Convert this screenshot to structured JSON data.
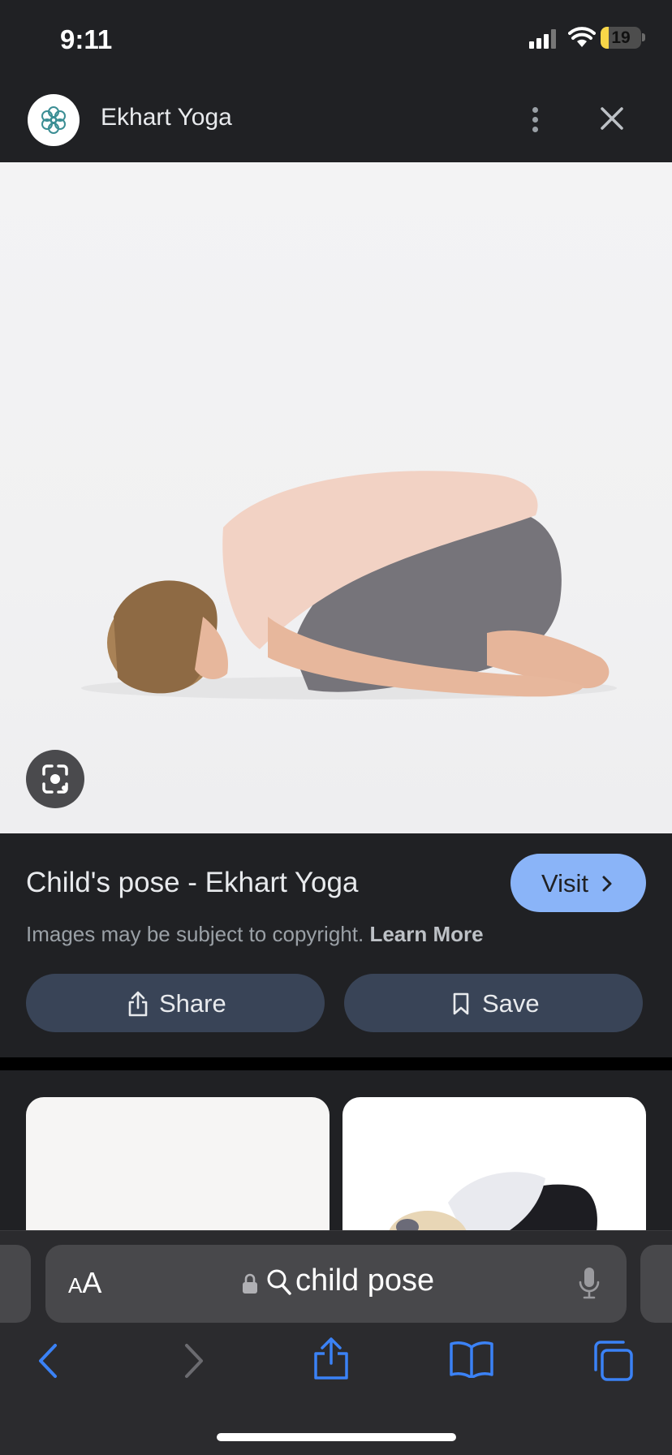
{
  "status_bar": {
    "time": "9:11",
    "battery": "19",
    "battery_level": 0.19
  },
  "site": {
    "name": "Ekhart Yoga"
  },
  "result": {
    "title": "Child's pose - Ekhart Yoga",
    "visit_label": "Visit",
    "copyright_text": "Images may be subject to copyright.",
    "learn_more": "Learn More",
    "share_label": "Share",
    "save_label": "Save"
  },
  "browser": {
    "aa_small": "A",
    "aa_large": "A",
    "query": "child pose"
  },
  "colors": {
    "accent": "#8ab4f8",
    "ios_blue": "#3b82f6",
    "pill": "#394457",
    "background": "#202124"
  },
  "icons": [
    "signal-icon",
    "wifi-icon",
    "battery-icon",
    "site-logo-icon",
    "more-vert-icon",
    "close-icon",
    "lens-icon",
    "chevron-right-icon",
    "share-icon",
    "bookmark-icon",
    "lock-icon",
    "search-icon",
    "mic-icon",
    "back-icon",
    "forward-icon",
    "share-sheet-icon",
    "bookmarks-icon",
    "tabs-icon"
  ]
}
